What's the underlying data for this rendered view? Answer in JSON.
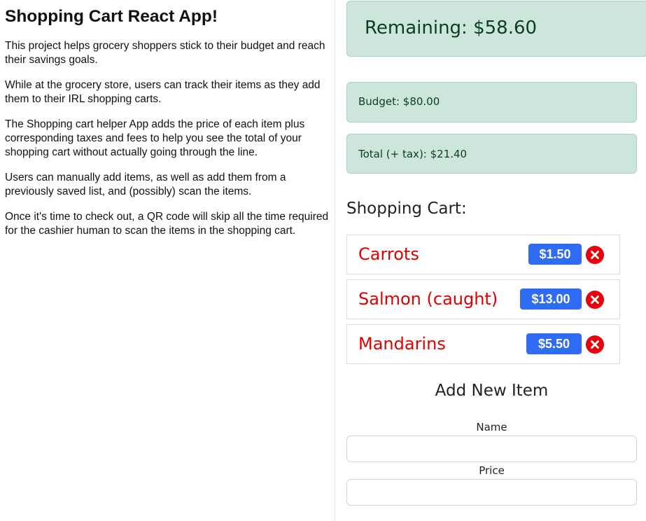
{
  "intro": {
    "title": "Shopping Cart React App!",
    "paragraphs": [
      "This project helps grocery shoppers stick to their budget and reach their savings goals.",
      "While at the grocery store, users can track their items as they add them to their IRL shopping carts.",
      "The Shopping cart helper App adds the price of each item plus corresponding taxes and fees to help you see the total of your shopping cart without actually going through the line.",
      "Users can manually add items, as well as add them from a previously saved list, and (possibly) scan the items.",
      "Once it's time to check out, a QR code will skip all the time required for the cashier human to scan the items in the shopping cart."
    ]
  },
  "summary": {
    "remaining": "Remaining: $58.60",
    "budget": "Budget: $80.00",
    "total": "Total (+ tax): $21.40"
  },
  "cart": {
    "title": "Shopping Cart:",
    "items": [
      {
        "name": "Carrots",
        "price": "$1.50"
      },
      {
        "name": "Salmon (caught)",
        "price": "$13.00"
      },
      {
        "name": "Mandarins",
        "price": "$5.50"
      }
    ]
  },
  "add_form": {
    "title": "Add New Item",
    "name_label": "Name",
    "name_value": "",
    "price_label": "Price",
    "price_value": ""
  },
  "colors": {
    "alert_bg": "#cde6dc",
    "item_name": "#e00000",
    "price_badge": "#2f6cf3",
    "remove_icon": "#e8000b"
  }
}
